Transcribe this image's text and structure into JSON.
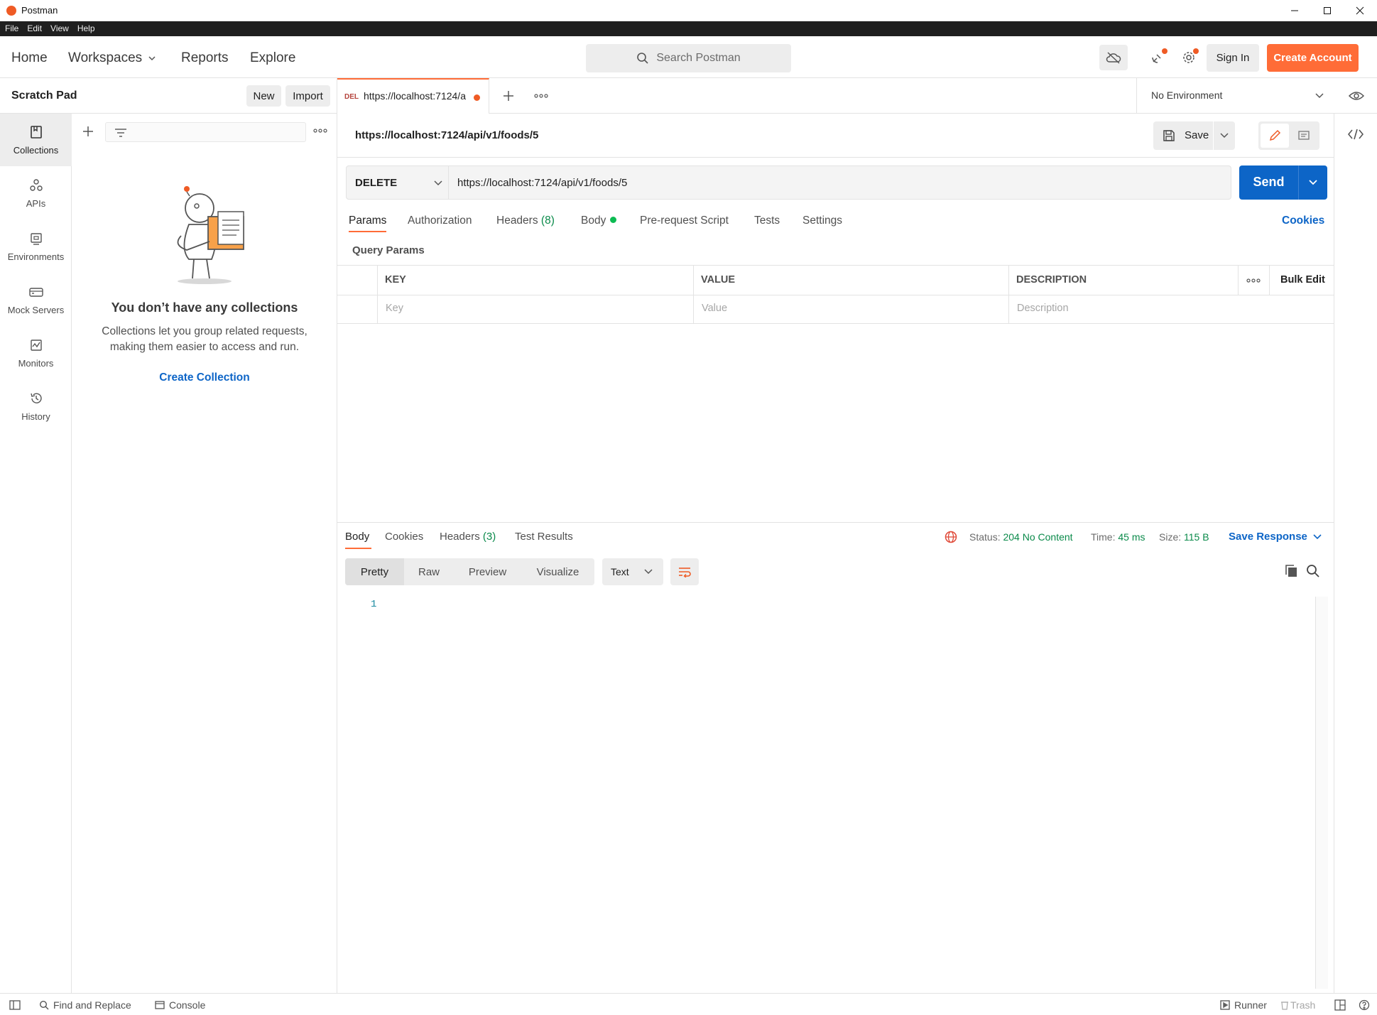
{
  "window": {
    "title": "Postman"
  },
  "menu": [
    "File",
    "Edit",
    "View",
    "Help"
  ],
  "header": {
    "nav": {
      "home": "Home",
      "workspaces": "Workspaces",
      "reports": "Reports",
      "explore": "Explore"
    },
    "search_placeholder": "Search Postman",
    "sign_in": "Sign In",
    "create_account": "Create Account"
  },
  "sidebar": {
    "workspace_name": "Scratch Pad",
    "new_label": "New",
    "import_label": "Import",
    "rail": [
      {
        "label": "Collections",
        "icon": "collections-icon"
      },
      {
        "label": "APIs",
        "icon": "apis-icon"
      },
      {
        "label": "Environments",
        "icon": "environments-icon"
      },
      {
        "label": "Mock Servers",
        "icon": "mock-servers-icon"
      },
      {
        "label": "Monitors",
        "icon": "monitors-icon"
      },
      {
        "label": "History",
        "icon": "history-icon"
      }
    ],
    "empty_title": "You don’t have any collections",
    "empty_desc": "Collections let you group related requests, making them easier to access and run.",
    "create_collection": "Create Collection"
  },
  "tabs": {
    "active": {
      "method": "DEL",
      "title": "https://localhost:7124/a"
    },
    "environment": "No Environment"
  },
  "request": {
    "name": "https://localhost:7124/api/v1/foods/5",
    "save_label": "Save",
    "method": "DELETE",
    "url": "https://localhost:7124/api/v1/foods/5",
    "send_label": "Send",
    "tabs": {
      "params": "Params",
      "authorization": "Authorization",
      "headers": "Headers",
      "headers_count": "(8)",
      "body": "Body",
      "prerequest": "Pre-request Script",
      "tests": "Tests",
      "settings": "Settings"
    },
    "cookies_link": "Cookies",
    "query_params_title": "Query Params",
    "table": {
      "headers": {
        "key": "KEY",
        "value": "VALUE",
        "description": "DESCRIPTION"
      },
      "bulk_edit": "Bulk Edit",
      "placeholders": {
        "key": "Key",
        "value": "Value",
        "description": "Description"
      }
    }
  },
  "response": {
    "tabs": {
      "body": "Body",
      "cookies": "Cookies",
      "headers": "Headers",
      "headers_count": "(3)",
      "test_results": "Test Results"
    },
    "status_label": "Status:",
    "status_value": "204 No Content",
    "time_label": "Time:",
    "time_value": "45 ms",
    "size_label": "Size:",
    "size_value": "115 B",
    "save_response": "Save Response",
    "views": [
      "Pretty",
      "Raw",
      "Preview",
      "Visualize"
    ],
    "format": "Text",
    "line_number": "1"
  },
  "statusbar": {
    "find_replace": "Find and Replace",
    "console": "Console",
    "runner": "Runner",
    "trash": "Trash"
  },
  "colors": {
    "accent": "#ff6c37",
    "primary": "#0d65c7",
    "success": "#0a8a4a"
  }
}
